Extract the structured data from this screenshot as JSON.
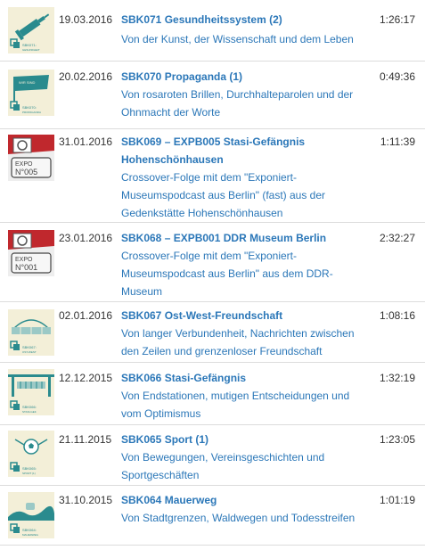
{
  "episodes": [
    {
      "date": "19.03.2016",
      "title": "SBK071 Gesundheitssystem (2)",
      "description": "Von der Kunst, der Wissenschaft und dem Leben",
      "duration": "1:26:17",
      "thumbnail": {
        "icon": "syringe-icon",
        "caption": "SBK071: GESUNDHEITSSYSTEM (2)"
      }
    },
    {
      "date": "20.02.2016",
      "title": "SBK070 Propaganda (1)",
      "description": "Von rosaroten Brillen, Durchhalteparolen und der Ohnmacht der Worte",
      "duration": "0:49:36",
      "thumbnail": {
        "icon": "flag-icon",
        "caption": "SBK070: PROPAGANDA (1)"
      }
    },
    {
      "date": "31.01.2016",
      "title": "SBK069 – EXPB005 Stasi-Gefängnis Hohenschönhausen",
      "description": "Crossover-Folge mit dem \"Exponiert-Museumspodcast aus Berlin\" (fast) aus der Gedenkstätte Hohenschönhausen",
      "duration": "1:11:39",
      "thumbnail": {
        "icon": "expo-podcast-logo-icon",
        "caption": "EXPO N°005"
      }
    },
    {
      "date": "23.01.2016",
      "title": "SBK068 – EXPB001 DDR Museum Berlin",
      "description": "Crossover-Folge mit dem \"Exponiert-Museumspodcast aus Berlin\" aus dem DDR-Museum",
      "duration": "2:32:27",
      "thumbnail": {
        "icon": "expo-podcast-logo-icon",
        "caption": "EXPO N°001"
      }
    },
    {
      "date": "02.01.2016",
      "title": "SBK067 Ost-West-Freundschaft",
      "description": "Von langer Verbundenheit, Nachrichten zwischen den Zeilen und grenzenloser Freundschaft",
      "duration": "1:08:16",
      "thumbnail": {
        "icon": "wall-arch-icon",
        "caption": "SBK067: OST-WEST-FREUNDSCHAFT"
      }
    },
    {
      "date": "12.12.2015",
      "title": "SBK066 Stasi-Gefängnis",
      "description": "Von Endstationen, mutigen Entscheidungen und vom Optimismus",
      "duration": "1:32:19",
      "thumbnail": {
        "icon": "prison-wall-icon",
        "caption": "SBK066: STASI-GEFÄNGNIS"
      }
    },
    {
      "date": "21.11.2015",
      "title": "SBK065 Sport (1)",
      "description": "Von Bewegungen, Vereinsgeschichten und Sportgeschäften",
      "duration": "1:23:05",
      "thumbnail": {
        "icon": "soccer-ball-icon",
        "caption": "SBK065: SPORT (1)"
      }
    },
    {
      "date": "31.10.2015",
      "title": "SBK064 Mauerweg",
      "description": "Von Stadtgrenzen, Waldwegen und Todesstreifen",
      "duration": "1:01:19",
      "thumbnail": {
        "icon": "landscape-icon",
        "caption": "SBK064: MAUERWEG"
      }
    }
  ],
  "colors": {
    "link": "#2b77b8",
    "text": "#333333",
    "divider": "#dcdcdc",
    "thumb_bg": "#f3efd8",
    "thumb_teal": "#2a8b8e",
    "expo_red": "#c0282d"
  }
}
